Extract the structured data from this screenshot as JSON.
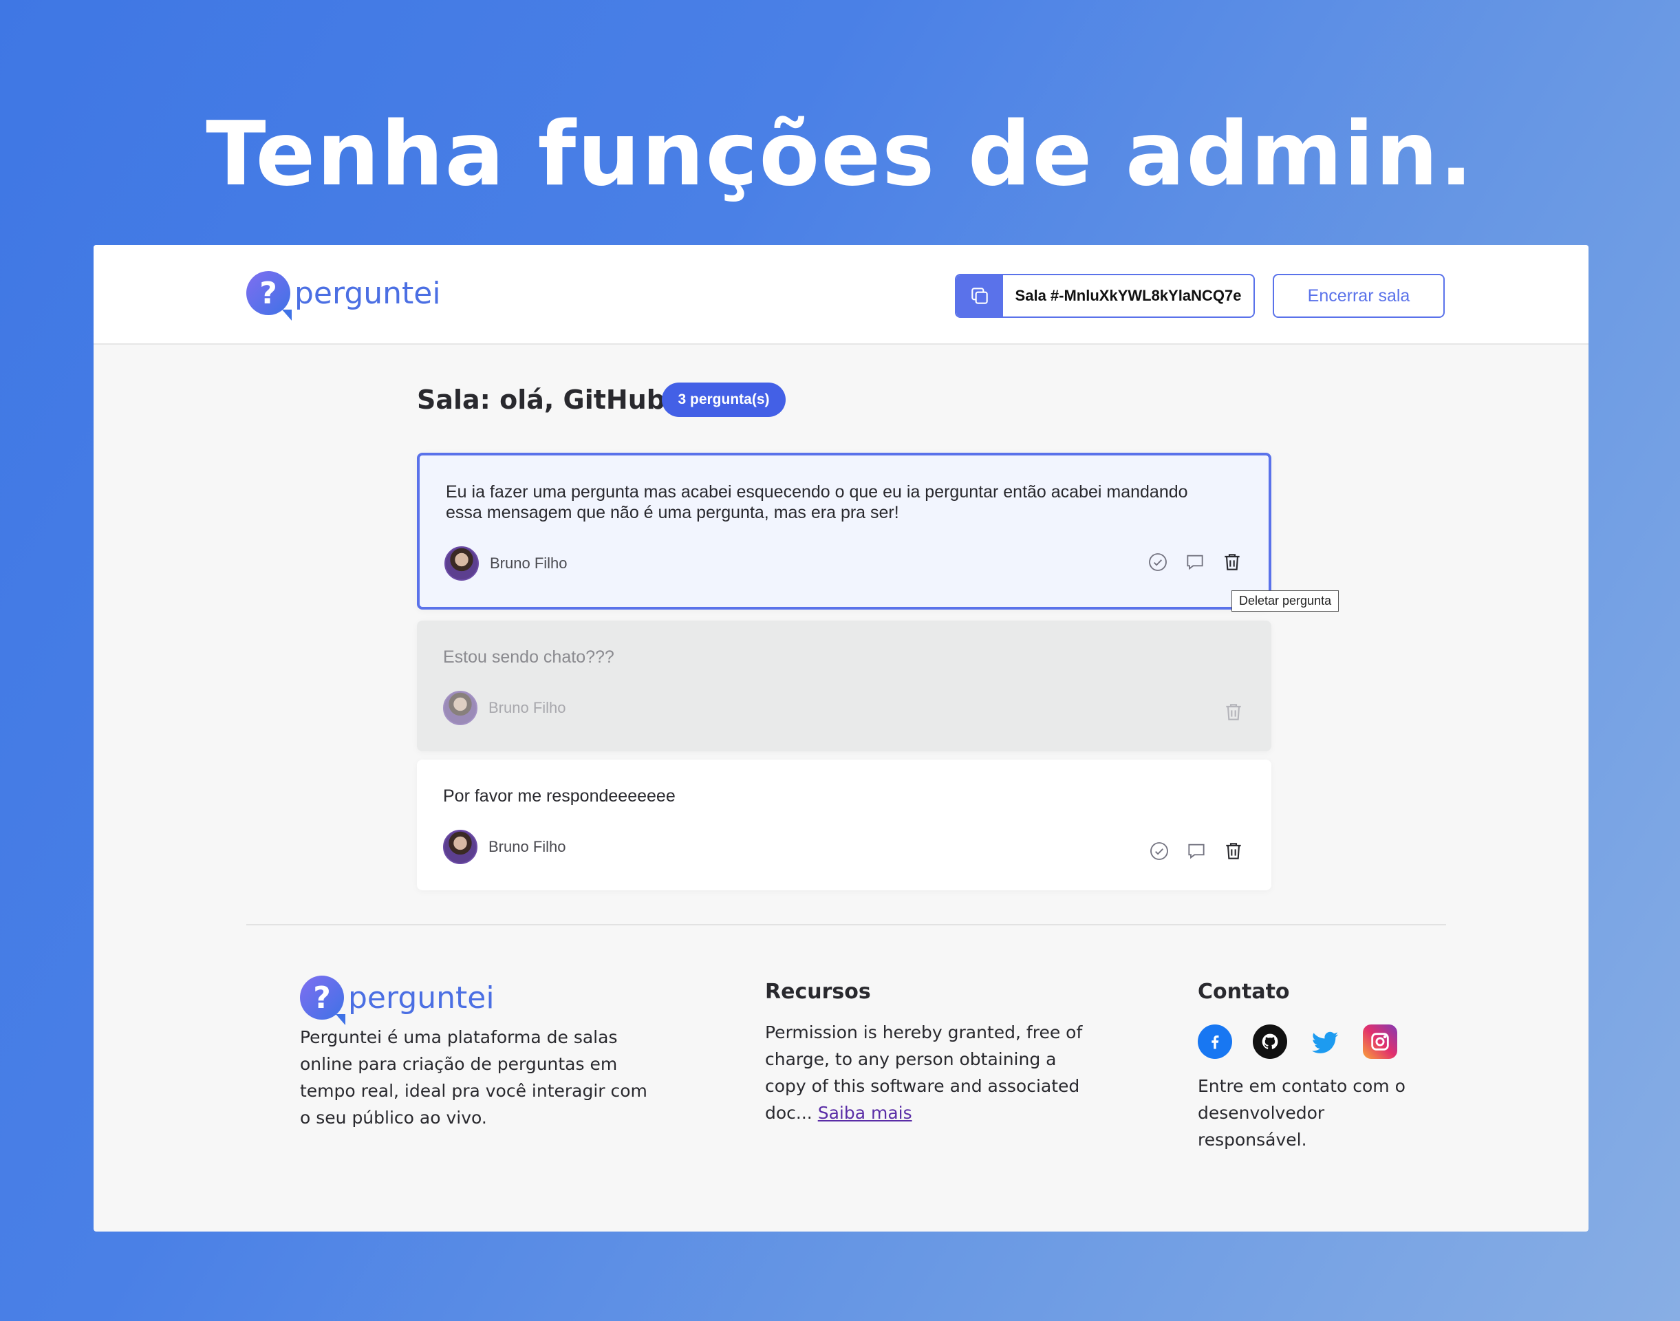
{
  "headline": "Tenha funções de admin.",
  "header": {
    "logo_text": "perguntei",
    "room_code": "Sala #-MnluXkYWL8kYlaNCQ7e",
    "end_room_label": "Encerrar sala"
  },
  "room": {
    "title": "Sala: olá, GitHub!",
    "question_count": "3 pergunta(s)"
  },
  "questions": [
    {
      "content": "Eu ia fazer uma pergunta mas acabei esquecendo o que eu ia perguntar então acabei mandando essa mensagem que não é uma pergunta, mas era pra ser!",
      "author": "Bruno Filho",
      "state": "highlighted"
    },
    {
      "content": "Estou sendo chato???",
      "author": "Bruno Filho",
      "state": "answered"
    },
    {
      "content": "Por favor me respondeeeeeee",
      "author": "Bruno Filho",
      "state": "default"
    }
  ],
  "tooltip": "Deletar pergunta",
  "footer": {
    "brand": {
      "logo_text": "perguntei",
      "description": "Perguntei é uma plataforma de salas online para criação de perguntas em tempo real, ideal pra você interagir com o seu público ao vivo."
    },
    "resources": {
      "title": "Recursos",
      "text": "Permission is hereby granted, free of charge, to any person obtaining a copy of this software and associated doc...",
      "link": "Saiba mais"
    },
    "contact": {
      "title": "Contato",
      "text": "Entre em contato com o desenvolvedor responsável.",
      "socials": [
        "facebook-icon",
        "github-icon",
        "twitter-icon",
        "instagram-icon"
      ]
    }
  },
  "colors": {
    "accent": "#5a72ea",
    "badge": "#4360e6"
  }
}
